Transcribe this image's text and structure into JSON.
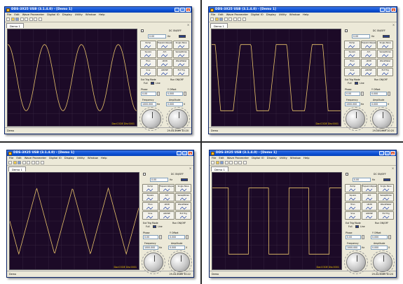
{
  "windows": [
    {
      "title": "DDS-3X25 USB (3.1.4.0) - [Demo 1]",
      "menu": [
        "File",
        "Edit",
        "Wave Parameter",
        "Digital IO",
        "Display",
        "Utility",
        "Window",
        "Help"
      ],
      "tab_label": "Demo 1",
      "waveform": "sine",
      "dac_text": "DacCODE Dis:0001",
      "status_left": "Demo",
      "status_right": "29-04-2009 10:20",
      "panel": {
        "frequency_label": "Frequency",
        "frequency": "1000.000",
        "amplitude_label": "Amplitude",
        "amplitude": "0.000",
        "phase_label": "Phase",
        "phase": "0.00",
        "offset_label": "Y Offset",
        "offset": "0.000",
        "dc_label": "DC ON/OFF",
        "ext_label": "Ext Trig Mode",
        "ext_value": "Full",
        "ext_value2": "Line",
        "run_label": "Run ON/OFF",
        "hz": "Hz",
        "vpp": "V"
      }
    },
    {
      "title": "DDS-3X25 USB (3.1.4.0) - [Demo 1]",
      "menu": [
        "File",
        "Edit",
        "Wave Parameter",
        "Digital IO",
        "Display",
        "Utility",
        "Window",
        "Help"
      ],
      "tab_label": "Demo 1",
      "waveform": "trapezoid",
      "dac_text": "DacCODE Dis:0001",
      "status_left": "Demo",
      "status_right": "29-04-2009 10:20",
      "panel": {
        "frequency_label": "Frequency",
        "frequency": "1000.000",
        "amplitude_label": "Amplitude",
        "amplitude": "0.000",
        "phase_label": "Phase",
        "phase": "0.00",
        "offset_label": "Y Offset",
        "offset": "0.000",
        "dc_label": "DC ON/OFF",
        "ext_label": "Ext Trig Mode",
        "ext_value": "Full",
        "ext_value2": "Line",
        "run_label": "Run ON/OFF",
        "hz": "Hz",
        "vpp": "V"
      }
    },
    {
      "title": "DDS-3X25 USB (3.1.4.0) - [Demo 1]",
      "menu": [
        "File",
        "Edit",
        "Wave Parameter",
        "Digital IO",
        "Display",
        "Utility",
        "Window",
        "Help"
      ],
      "tab_label": "Demo 1",
      "waveform": "triangle",
      "dac_text": "DacCODE Dis:0001",
      "status_left": "Demo",
      "status_right": "29-04-2009 10:22",
      "panel": {
        "frequency_label": "Frequency",
        "frequency": "1000.000",
        "amplitude_label": "Amplitude",
        "amplitude": "0.000",
        "phase_label": "Phase",
        "phase": "0.00",
        "offset_label": "Y Offset",
        "offset": "0.000",
        "dc_label": "DC ON/OFF",
        "ext_label": "Ext Trig Mode",
        "ext_value": "Full",
        "ext_value2": "Line",
        "run_label": "Run ON/OFF",
        "hz": "Hz",
        "vpp": "V"
      }
    },
    {
      "title": "DDS-3X25 USB (3.1.4.0) - [Demo 1]",
      "menu": [
        "File",
        "Edit",
        "Wave Parameter",
        "Digital IO",
        "Display",
        "Utility",
        "Window",
        "Help"
      ],
      "tab_label": "Demo 1",
      "waveform": "square",
      "dac_text": "DacCODE Dis:0001",
      "status_left": "Demo",
      "status_right": "29-04-2009 10:20",
      "panel": {
        "frequency_label": "Frequency",
        "frequency": "1000.000",
        "amplitude_label": "Amplitude",
        "amplitude": "0.000",
        "phase_label": "Phase",
        "phase": "0.00",
        "offset_label": "Y Offset",
        "offset": "0.000",
        "dc_label": "DC ON/OFF",
        "ext_label": "Ext Trig Mode",
        "ext_value": "Full",
        "ext_value2": "Line",
        "run_label": "Run ON/OFF",
        "hz": "Hz",
        "vpp": "V"
      }
    }
  ],
  "wave_buttons": [
    "Ramp",
    "TrapezoidAppend",
    "Single Nave",
    "Square",
    "Arb",
    "SweepNoise",
    "Trian",
    "sRUN",
    "WaveMaker",
    "Sine",
    "sNOISE",
    "Ext Trig"
  ],
  "colors": {
    "trace": "#e9c46a",
    "grid": "#3a2a45",
    "scope_bg": "#1c0a27",
    "title_blue": "#0a4fd4"
  }
}
